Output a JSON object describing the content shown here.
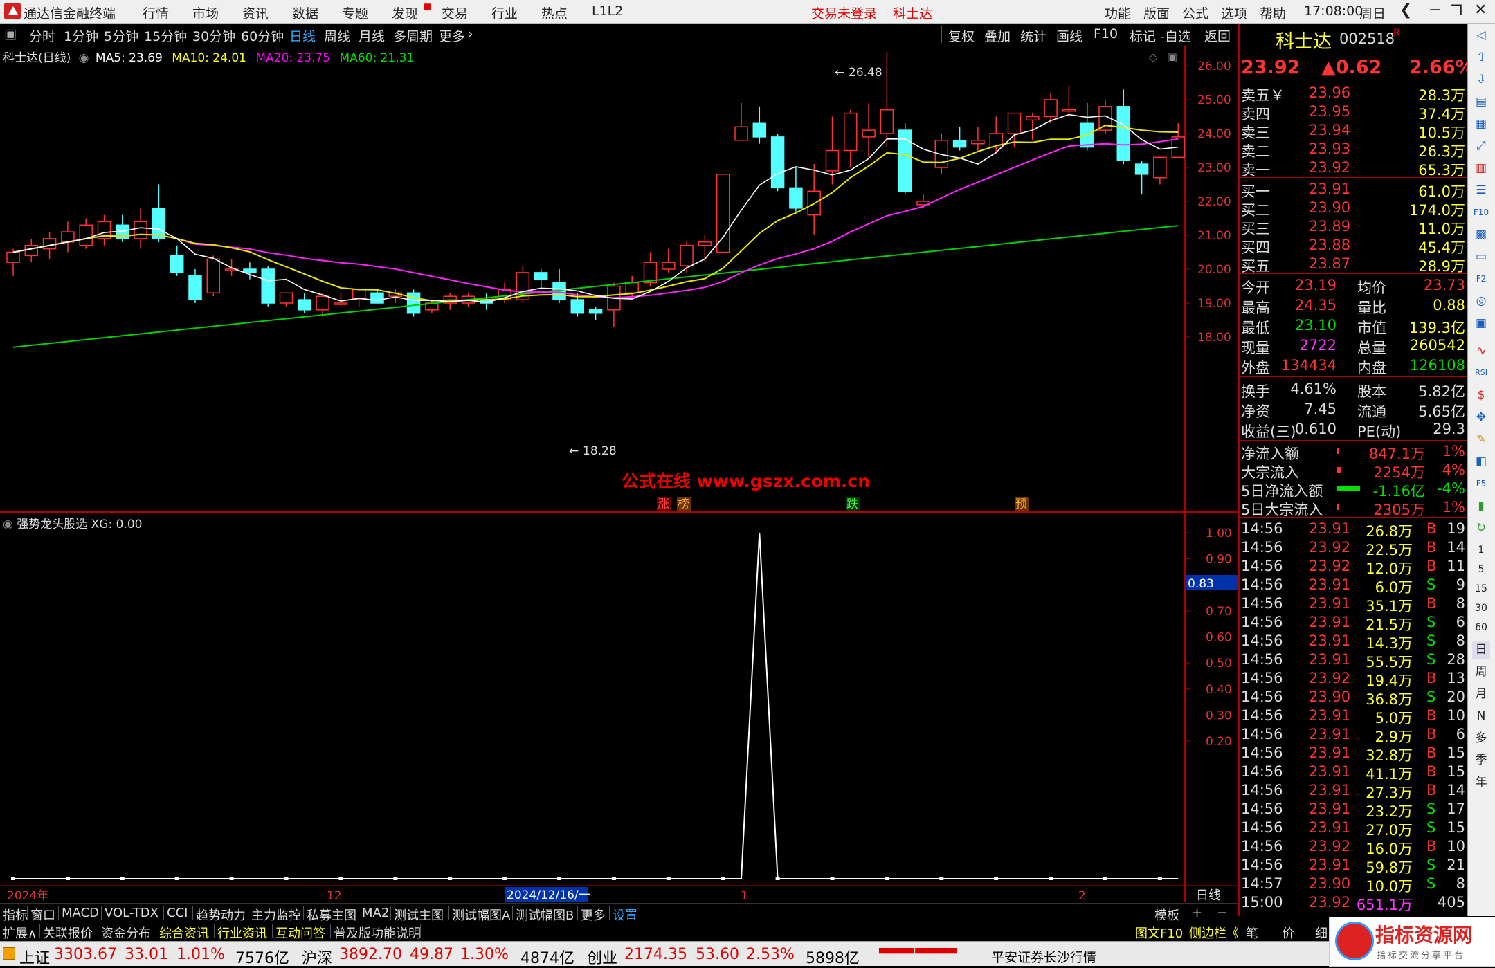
{
  "app": {
    "title": "通达信金融终端",
    "menu": [
      "行情",
      "市场",
      "资讯",
      "数据",
      "专题",
      "发现",
      "交易",
      "行业",
      "热点",
      "L1L2"
    ],
    "login": "交易未登录",
    "stock_name_top": "科士达",
    "right_menu": [
      "功能",
      "版面",
      "公式",
      "选项",
      "帮助"
    ],
    "time": "17:08:00",
    "weekday": "周日"
  },
  "toolbar": {
    "periods": [
      "分时",
      "1分钟",
      "5分钟",
      "15分钟",
      "30分钟",
      "60分钟",
      "日线",
      "周线",
      "月线",
      "多周期",
      "更多"
    ],
    "selected": "日线",
    "actions": [
      "复权",
      "叠加",
      "统计",
      "画线",
      "F10",
      "标记",
      "-自选",
      "返回"
    ]
  },
  "main_chart": {
    "legend": {
      "name": "科士达(日线)",
      "ma5": "MA5: 23.69",
      "ma10": "MA10: 24.01",
      "ma20": "MA20: 23.75",
      "ma60": "MA60: 21.31"
    },
    "high_label": "26.48",
    "low_label": "18.28",
    "watermark": "公式在线  www.gszx.com.cn",
    "markers": [
      "涨",
      "榜",
      "跌",
      "预"
    ],
    "y_ticks": [
      "26.00",
      "25.00",
      "24.00",
      "23.00",
      "22.00",
      "21.00",
      "20.00",
      "19.00",
      "18.00"
    ]
  },
  "indicator": {
    "legend": "强势龙头股选 XG: 0.00",
    "cursor_value": "0.83",
    "y_ticks": [
      "1.00",
      "0.90",
      "0.80",
      "0.70",
      "0.60",
      "0.50",
      "0.40",
      "0.30",
      "0.20"
    ]
  },
  "x_axis": {
    "labels": [
      "2024年",
      "12",
      "2024/12/16/一",
      "1",
      "2"
    ],
    "period_label": "日线"
  },
  "quote": {
    "name": "科士达",
    "code": "002518",
    "flag": "R",
    "price": "23.92",
    "change": "▲0.62",
    "pct": "2.66%",
    "asks": [
      [
        "卖五￥",
        "23.96",
        "28.3万"
      ],
      [
        "卖四",
        "23.95",
        "37.4万"
      ],
      [
        "卖三",
        "23.94",
        "10.5万"
      ],
      [
        "卖二",
        "23.93",
        "26.3万"
      ],
      [
        "卖一",
        "23.92",
        "65.3万"
      ]
    ],
    "bids": [
      [
        "买一",
        "23.91",
        "61.0万"
      ],
      [
        "买二",
        "23.90",
        "174.0万"
      ],
      [
        "买三",
        "23.89",
        "11.0万"
      ],
      [
        "买四",
        "23.88",
        "45.4万"
      ],
      [
        "买五",
        "23.87",
        "28.9万"
      ]
    ],
    "stats": [
      [
        "今开",
        "23.19",
        "均价",
        "23.73"
      ],
      [
        "最高",
        "24.35",
        "量比",
        "0.88"
      ],
      [
        "最低",
        "23.10",
        "市值",
        "139.3亿"
      ],
      [
        "现量",
        "2722",
        "总量",
        "260542"
      ],
      [
        "外盘",
        "134434",
        "内盘",
        "126108"
      ]
    ],
    "stats2": [
      [
        "换手",
        "4.61%",
        "股本",
        "5.82亿"
      ],
      [
        "净资",
        "7.45",
        "流通",
        "5.65亿"
      ],
      [
        "收益(三)",
        "0.610",
        "PE(动)",
        "29.3"
      ]
    ],
    "flows": [
      [
        "净流入额",
        "847.1万",
        "1%"
      ],
      [
        "大宗流入",
        "2254万",
        "4%"
      ],
      [
        "5日净流入额",
        "-1.16亿",
        "-4%"
      ],
      [
        "5日大宗流入",
        "2305万",
        "1%"
      ]
    ],
    "ticks": [
      [
        "14:56",
        "23.91",
        "26.8万",
        "B",
        "19"
      ],
      [
        "14:56",
        "23.92",
        "22.5万",
        "B",
        "14"
      ],
      [
        "14:56",
        "23.92",
        "12.0万",
        "B",
        "11"
      ],
      [
        "14:56",
        "23.91",
        "6.0万",
        "S",
        "9"
      ],
      [
        "14:56",
        "23.91",
        "35.1万",
        "B",
        "8"
      ],
      [
        "14:56",
        "23.91",
        "21.5万",
        "S",
        "6"
      ],
      [
        "14:56",
        "23.91",
        "14.3万",
        "S",
        "8"
      ],
      [
        "14:56",
        "23.91",
        "55.5万",
        "S",
        "28"
      ],
      [
        "14:56",
        "23.92",
        "19.4万",
        "B",
        "13"
      ],
      [
        "14:56",
        "23.90",
        "36.8万",
        "S",
        "20"
      ],
      [
        "14:56",
        "23.91",
        "5.0万",
        "B",
        "10"
      ],
      [
        "14:56",
        "23.91",
        "2.9万",
        "B",
        "6"
      ],
      [
        "14:56",
        "23.91",
        "32.8万",
        "B",
        "15"
      ],
      [
        "14:56",
        "23.91",
        "41.1万",
        "B",
        "15"
      ],
      [
        "14:56",
        "23.91",
        "27.3万",
        "B",
        "14"
      ],
      [
        "14:56",
        "23.91",
        "23.2万",
        "S",
        "17"
      ],
      [
        "14:56",
        "23.91",
        "27.0万",
        "S",
        "15"
      ],
      [
        "14:56",
        "23.92",
        "16.0万",
        "B",
        "10"
      ],
      [
        "14:56",
        "23.91",
        "59.8万",
        "S",
        "21"
      ],
      [
        "14:57",
        "23.90",
        "10.0万",
        "S",
        "8"
      ],
      [
        "15:00",
        "23.92",
        "651.1万",
        "",
        "405"
      ]
    ]
  },
  "sidebar": {
    "labels": [
      "日",
      "周",
      "月",
      "N",
      "多",
      "季",
      "年"
    ]
  },
  "bottom_tabs": [
    "指标",
    "窗口",
    "MACD",
    "VOL-TDX",
    "CCI",
    "趋势动力",
    "主力监控",
    "私募主图",
    "MA2",
    "测试主图",
    "测试幅图A",
    "测试幅图B",
    "更多",
    "设置"
  ],
  "bottom_right": [
    "模板",
    "+",
    "−"
  ],
  "bottom_tabs2": [
    "扩展∧",
    "关联报价",
    "资金分布",
    "综合资讯",
    "行业资讯",
    "互动问答",
    "普及版功能说明"
  ],
  "bottom_right2": [
    "图文F10",
    "侧边栏《",
    "笔",
    "价",
    "细"
  ],
  "status": {
    "indices": [
      [
        "上证",
        "3303.67",
        "33.01",
        "1.01%",
        "7576亿"
      ],
      [
        "沪深",
        "3892.70",
        "49.87",
        "1.30%",
        "4874亿"
      ],
      [
        "创业",
        "2174.35",
        "53.60",
        "2.53%",
        "5898亿"
      ]
    ],
    "broker": "平安证券长沙行情",
    "site_logo": "指标资源网",
    "site_sub": "指标交流分享平台"
  },
  "colors": {
    "up": "#ff3333",
    "down": "#54ffff",
    "ma5": "#ffffff",
    "ma10": "#ffff00",
    "ma20": "#ff00ff",
    "ma60": "#00e000",
    "accent": "#e00000"
  }
}
